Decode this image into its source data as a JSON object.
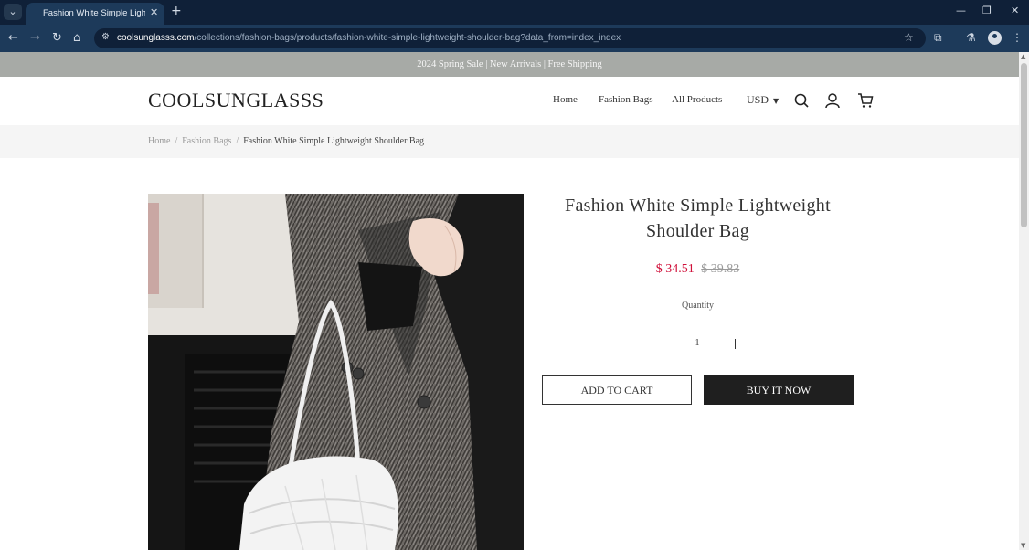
{
  "browser": {
    "tab_title": "Fashion White Simple Lightweight Shoulder Bag",
    "url_host": "coolsunglasss.com",
    "url_path": "/collections/fashion-bags/products/fashion-white-simple-lightweight-shoulder-bag?data_from=index_index"
  },
  "announcement": "2024 Spring Sale | New Arrivals | Free Shipping",
  "header": {
    "logo": "COOLSUNGLASSS",
    "nav": [
      "Home",
      "Fashion Bags",
      "All Products"
    ],
    "currency": "USD"
  },
  "breadcrumb": {
    "items": [
      "Home",
      "Fashion Bags"
    ],
    "current": "Fashion White Simple Lightweight Shoulder Bag"
  },
  "product": {
    "title": "Fashion White Simple Lightweight Shoulder Bag",
    "price": "$ 34.51",
    "compare_price": "$ 39.83",
    "quantity_label": "Quantity",
    "quantity": "1",
    "add_to_cart": "ADD TO CART",
    "buy_now": "BUY IT NOW"
  },
  "colors": {
    "chrome": "#1d3a5a",
    "announcement_bg": "#a7aaa6",
    "sale_price": "#d0103a",
    "buy_button": "#1f1f1f"
  }
}
